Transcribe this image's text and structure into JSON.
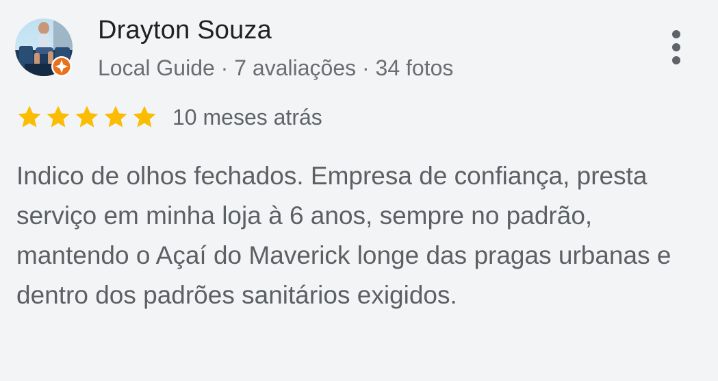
{
  "review": {
    "author": {
      "name": "Drayton Souza",
      "meta": "Local Guide · 7 avaliações · 34 fotos",
      "avatar_icon": "user-photo",
      "badge_icon": "local-guide-star-icon"
    },
    "menu_icon": "more-vert-icon",
    "rating": {
      "stars_filled": 5,
      "stars_total": 5,
      "star_color": "#fbbc04",
      "timestamp": "10 meses atrás"
    },
    "text": "Indico de olhos fechados. Empresa de confiança, presta serviço em minha loja à 6 anos, sempre no padrão, mantendo o Açaí do Maverick longe das pragas urbanas e dentro dos padrões sanitários exigidos."
  },
  "colors": {
    "background": "#f3f4f6",
    "name_text": "#202124",
    "meta_text": "#6a6d72",
    "body_text": "#5c5f63",
    "badge_orange": "#e8711c"
  }
}
